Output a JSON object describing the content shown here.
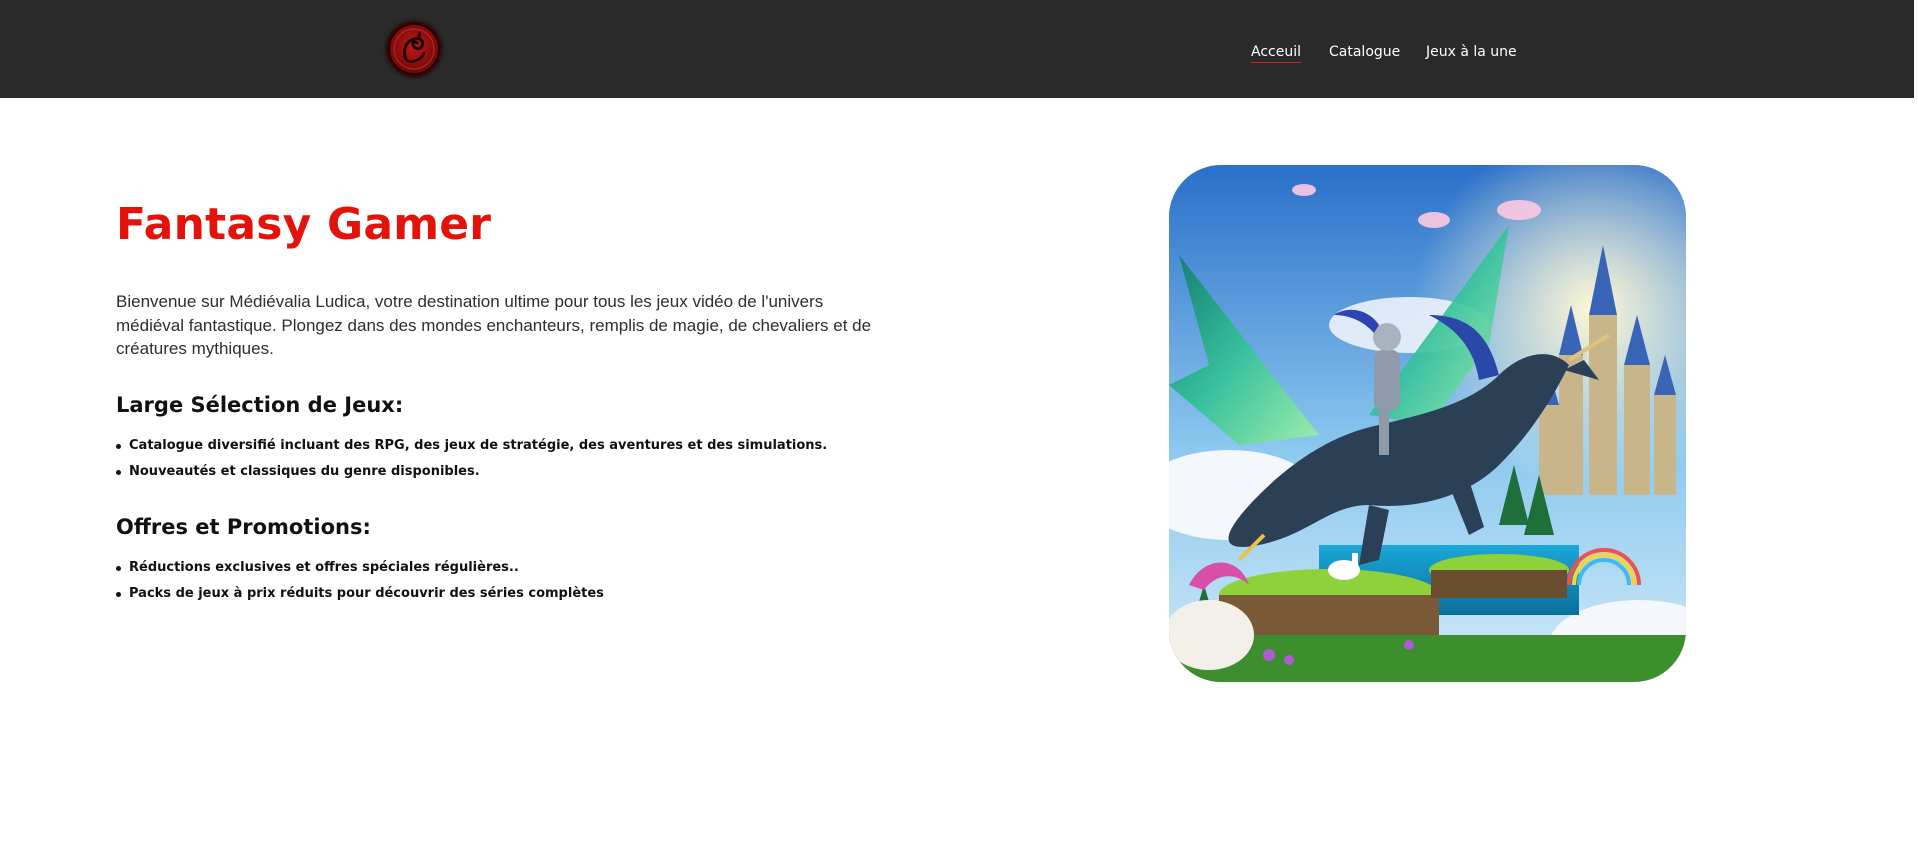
{
  "header": {
    "logo_icon": "dragon-emblem-icon",
    "nav": [
      {
        "label": "Acceuil",
        "active": true
      },
      {
        "label": "Catalogue",
        "active": false
      },
      {
        "label": "Jeux à la une",
        "active": false
      }
    ]
  },
  "main": {
    "title": "Fantasy Gamer",
    "intro": "Bienvenue sur Médiévalia Ludica, votre destination ultime pour tous les jeux vidéo de l'univers médiéval fantastique. Plongez dans des mondes enchanteurs, remplis de magie, de chevaliers et de créatures mythiques.",
    "sections": [
      {
        "heading": "Large Sélection de Jeux:",
        "items": [
          "Catalogue diversifié incluant des RPG, des jeux de stratégie, des aventures et des simulations.",
          "Nouveautés et classiques du genre disponibles."
        ]
      },
      {
        "heading": "Offres et Promotions:",
        "items": [
          "Réductions exclusives et offres spéciales régulières..",
          "Packs de jeux à prix réduits pour découvrir des séries complètes"
        ]
      }
    ],
    "hero_image_icon": "fantasy-knight-dragon-illustration"
  },
  "colors": {
    "navbar": "#2b2a2a",
    "accent": "#e3120b",
    "nav_text": "#ffffff",
    "body_text": "#2e2e2e"
  }
}
